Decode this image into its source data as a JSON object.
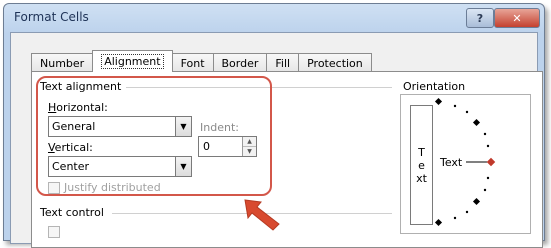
{
  "window": {
    "title": "Format Cells",
    "help_glyph": "?",
    "close_glyph": "✕"
  },
  "tabs": [
    {
      "label": "Number",
      "active": false
    },
    {
      "label": "Alignment",
      "active": true
    },
    {
      "label": "Font",
      "active": false
    },
    {
      "label": "Border",
      "active": false
    },
    {
      "label": "Fill",
      "active": false
    },
    {
      "label": "Protection",
      "active": false
    }
  ],
  "text_alignment": {
    "group_label": "Text alignment",
    "horizontal": {
      "label_key": "H",
      "label_rest": "orizontal:",
      "value": "General"
    },
    "vertical": {
      "label_key": "V",
      "label_rest": "ertical:",
      "value": "Center"
    },
    "indent": {
      "label": "Indent:",
      "value": "0"
    },
    "justify_distributed": {
      "label": "Justify distributed",
      "checked": false,
      "enabled": false
    }
  },
  "text_control": {
    "group_label": "Text control"
  },
  "orientation": {
    "group_label": "Orientation",
    "vertical_text": "Text",
    "dial_label": "Text"
  },
  "colors": {
    "highlight": "#d3574a",
    "arrow": "#d84a2f"
  }
}
